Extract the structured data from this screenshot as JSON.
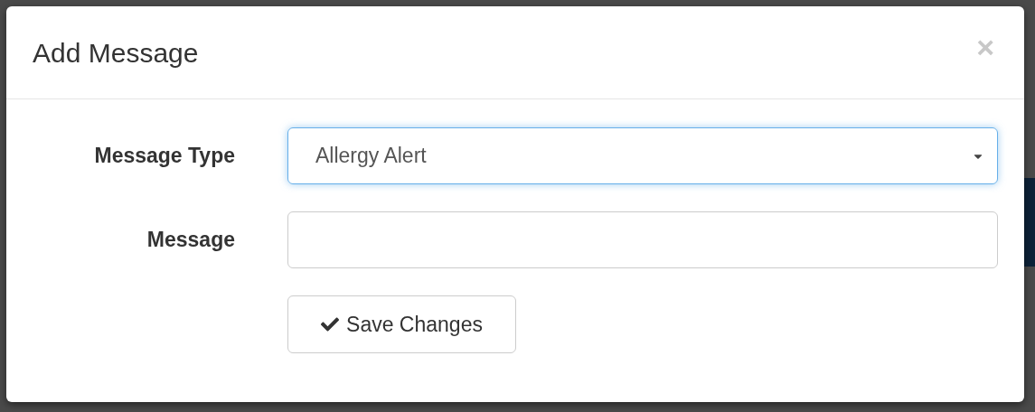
{
  "dialog": {
    "title": "Add Message",
    "close": "×"
  },
  "form": {
    "fields": [
      {
        "kind": "select",
        "label": "Message Type",
        "value": "Allergy Alert",
        "focused": true
      },
      {
        "kind": "text",
        "label": "Message",
        "focused": false
      }
    ],
    "submit": "Save Changes"
  }
}
